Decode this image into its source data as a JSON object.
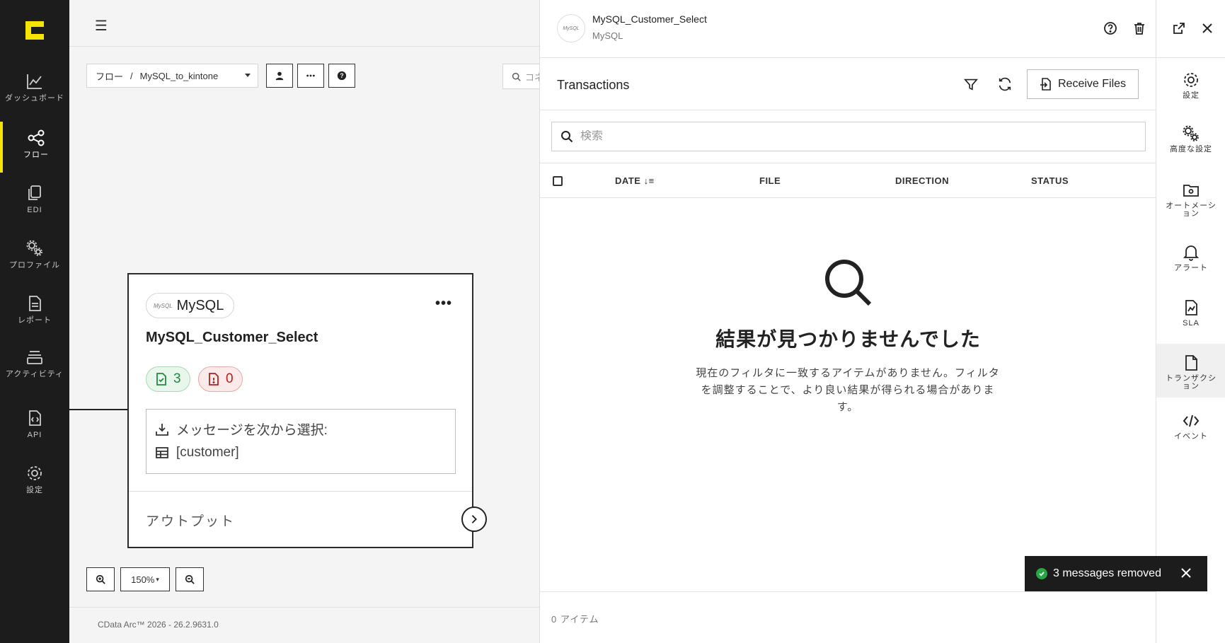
{
  "app": {
    "logo_letter": "C"
  },
  "leftnav": {
    "items": [
      {
        "label": "ダッシュボード",
        "icon": "chart-line-icon"
      },
      {
        "label": "フロー",
        "icon": "share-nodes-icon",
        "active": true
      },
      {
        "label": "EDI",
        "icon": "documents-icon"
      },
      {
        "label": "プロファイル",
        "icon": "gears-icon"
      },
      {
        "label": "レポート",
        "icon": "report-icon"
      },
      {
        "label": "アクティビティ",
        "icon": "layers-icon"
      },
      {
        "label": "API",
        "icon": "api-file-icon"
      },
      {
        "label": "設定",
        "icon": "gear-icon"
      }
    ]
  },
  "canvas": {
    "breadcrumb_root": "フロー",
    "breadcrumb_sep": "/",
    "flow_name": "MySQL_to_kintone",
    "search_placeholder": "コネ",
    "zoom_level": "150%",
    "footer": "CData Arc™ 2026 - 26.2.9631.0"
  },
  "node": {
    "connector_type": "MySQL",
    "connector_logo_text": "MySQL",
    "name": "MySQL_Customer_Select",
    "success_count": "3",
    "error_count": "0",
    "message_source_label": "メッセージを次から選択:",
    "table_name": "[customer]",
    "output_label": "アウトプット"
  },
  "panel": {
    "title": "MySQL_Customer_Select",
    "subtitle": "MySQL",
    "section_title": "Transactions",
    "receive_button": "Receive Files",
    "search_placeholder": "検索",
    "columns": [
      "DATE",
      "FILE",
      "DIRECTION",
      "STATUS"
    ],
    "empty_title": "結果が見つかりませんでした",
    "empty_desc": "現在のフィルタに一致するアイテムがありません。フィルタを調整することで、より良い結果が得られる場合があります。",
    "footer_count": "0 アイテム"
  },
  "rightnav": {
    "items": [
      {
        "label": "設定",
        "icon": "gear-icon"
      },
      {
        "label": "高度な設定",
        "icon": "gears-icon"
      },
      {
        "label": "オートメーション",
        "icon": "folder-gear-icon"
      },
      {
        "label": "アラート",
        "icon": "bell-icon"
      },
      {
        "label": "SLA",
        "icon": "sla-file-icon"
      },
      {
        "label": "トランザクション",
        "icon": "file-icon",
        "active": true
      },
      {
        "label": "イベント",
        "icon": "code-icon"
      }
    ]
  },
  "toast": {
    "message": "3 messages removed"
  },
  "colors": {
    "accent": "#f4e400",
    "success": "#27a745",
    "error": "#b42020",
    "sidebar_bg": "#1c1c1c"
  }
}
